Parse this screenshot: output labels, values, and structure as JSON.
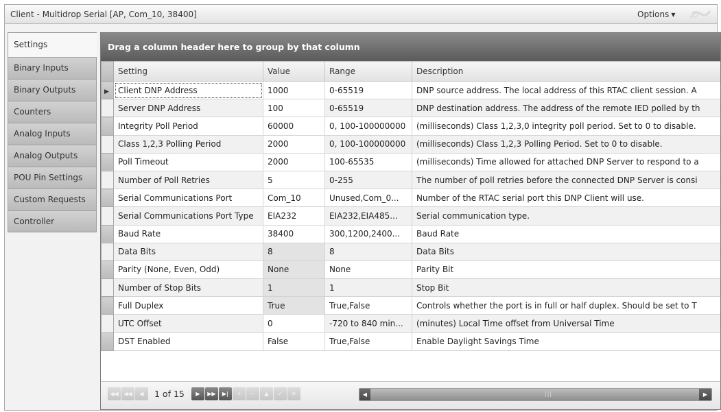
{
  "window": {
    "title": "Client - Multidrop Serial [AP, Com_10, 38400]",
    "options_label": "Options"
  },
  "tabs": [
    {
      "label": "Settings"
    },
    {
      "label": "Binary Inputs"
    },
    {
      "label": "Binary Outputs"
    },
    {
      "label": "Counters"
    },
    {
      "label": "Analog Inputs"
    },
    {
      "label": "Analog Outputs"
    },
    {
      "label": "POU Pin Settings"
    },
    {
      "label": "Custom Requests"
    },
    {
      "label": "Controller"
    }
  ],
  "grid": {
    "group_panel_text": "Drag a column header here to group by that column",
    "columns": [
      "Setting",
      "Value",
      "Range",
      "Description"
    ],
    "rows": [
      {
        "setting": "Client DNP Address",
        "value": "1000",
        "range": "0-65519",
        "description": "DNP source address. The local address of this RTAC client session. A"
      },
      {
        "setting": "Server DNP Address",
        "value": "100",
        "range": "0-65519",
        "description": "DNP destination address. The address of the remote IED polled by th"
      },
      {
        "setting": "Integrity Poll Period",
        "value": "60000",
        "range": "0, 100-100000000",
        "description": "(milliseconds) Class 1,2,3,0 integrity poll period. Set to 0 to disable."
      },
      {
        "setting": "Class 1,2,3 Polling Period",
        "value": "2000",
        "range": "0, 100-100000000",
        "description": "(milliseconds) Class 1,2,3 Polling Period. Set to 0 to disable."
      },
      {
        "setting": "Poll Timeout",
        "value": "2000",
        "range": "100-65535",
        "description": "(milliseconds) Time allowed for attached DNP Server to respond to a"
      },
      {
        "setting": "Number of Poll Retries",
        "value": "5",
        "range": "0-255",
        "description": "The number of poll retries before the connected DNP Server is consi"
      },
      {
        "setting": "Serial Communications Port",
        "value": "Com_10",
        "range": "Unused,Com_0...",
        "description": "Number of the RTAC serial port this DNP Client will use."
      },
      {
        "setting": "Serial Communications Port Type",
        "value": "EIA232",
        "range": "EIA232,EIA485...",
        "description": "Serial communication type."
      },
      {
        "setting": "Baud Rate",
        "value": "38400",
        "range": "300,1200,2400...",
        "description": "Baud Rate"
      },
      {
        "setting": "Data Bits",
        "value": "8",
        "range": "8",
        "description": "Data Bits"
      },
      {
        "setting": "Parity (None, Even, Odd)",
        "value": "None",
        "range": "None",
        "description": "Parity Bit"
      },
      {
        "setting": "Number of Stop Bits",
        "value": "1",
        "range": "1",
        "description": "Stop Bit"
      },
      {
        "setting": "Full Duplex",
        "value": "True",
        "range": "True,False",
        "description": "Controls whether the port is in full or half duplex.  Should be set to T"
      },
      {
        "setting": "UTC Offset",
        "value": "0",
        "range": "-720 to 840 min...",
        "description": "(minutes) Local Time offset from Universal Time"
      },
      {
        "setting": "DST Enabled",
        "value": "False",
        "range": "True,False",
        "description": "Enable Daylight Savings Time"
      }
    ]
  },
  "pager": {
    "page_text": "1 of 15"
  },
  "colors": {
    "group_panel": "#6e6e6e",
    "readonly_value": "#e3e3e3"
  }
}
